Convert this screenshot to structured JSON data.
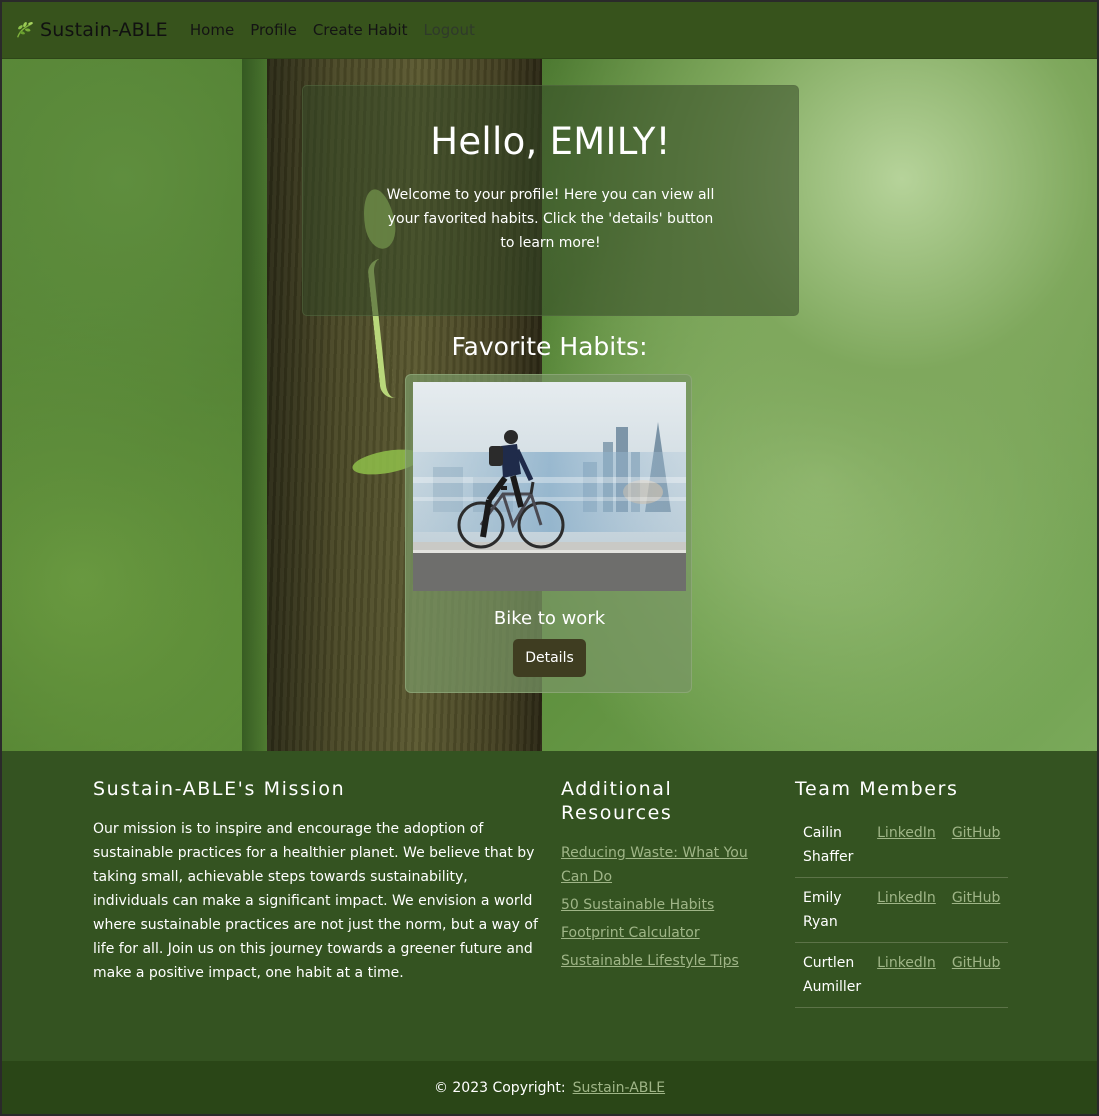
{
  "nav": {
    "brand": "Sustain-ABLE",
    "links": [
      "Home",
      "Profile",
      "Create Habit",
      "Logout"
    ]
  },
  "welcome": {
    "title": "Hello, EMILY!",
    "text": "Welcome to your profile! Here you can view all your favorited habits. Click the 'details' button to learn more!"
  },
  "favorites": {
    "title": "Favorite Habits:",
    "habits": [
      {
        "name": "Bike to work",
        "button": "Details"
      }
    ]
  },
  "footer": {
    "mission": {
      "title": "Sustain-ABLE's Mission",
      "text": "Our mission is to inspire and encourage the adoption of sustainable practices for a healthier planet. We believe that by taking small, achievable steps towards sustainability, individuals can make a significant impact. We envision a world where sustainable practices are not just the norm, but a way of life for all. Join us on this journey towards a greener future and make a positive impact, one habit at a time."
    },
    "resources": {
      "title": "Additional Resources",
      "links": [
        "Reducing Waste: What You Can Do",
        "50 Sustainable Habits",
        "Footprint Calculator",
        "Sustainable Lifestyle Tips"
      ]
    },
    "team": {
      "title": "Team Members",
      "members": [
        {
          "name": "Cailin Shaffer",
          "linkedin": "LinkedIn",
          "github": "GitHub"
        },
        {
          "name": "Emily Ryan",
          "linkedin": "LinkedIn",
          "github": "GitHub"
        },
        {
          "name": "Curtlen Aumiller",
          "linkedin": "LinkedIn",
          "github": "GitHub"
        }
      ]
    },
    "copyright": {
      "text": "© 2023 Copyright:",
      "link": "Sustain-ABLE"
    }
  },
  "colors": {
    "navbar": "#37531c",
    "footer": "#345321",
    "copyright_bar": "#2a4617",
    "link": "#9fb587",
    "button": "#3f3d21"
  }
}
